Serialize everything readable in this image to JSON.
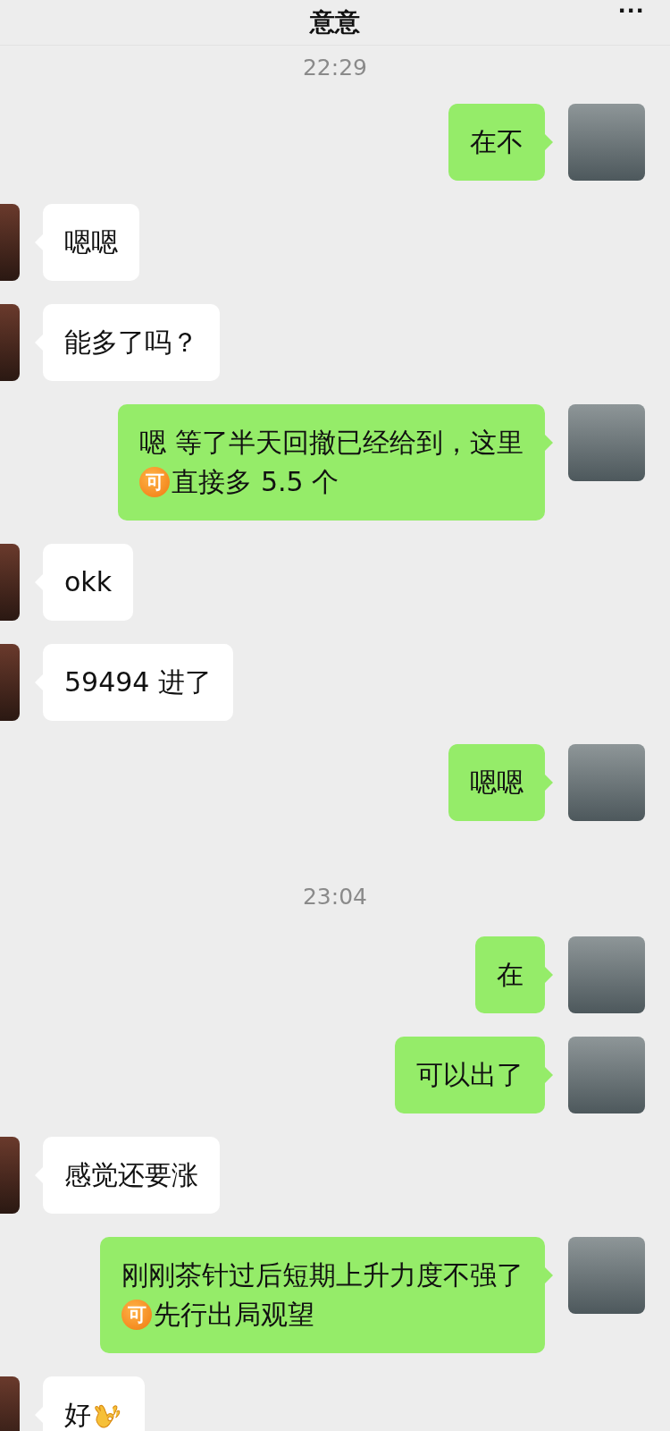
{
  "header": {
    "title": "意意",
    "more": "···"
  },
  "items": [
    {
      "kind": "time",
      "text": "22:29"
    },
    {
      "kind": "sent",
      "lines": [
        [
          {
            "kind": "text",
            "text": "在不"
          }
        ]
      ]
    },
    {
      "kind": "received",
      "lines": [
        [
          {
            "kind": "text",
            "text": "嗯嗯"
          }
        ]
      ]
    },
    {
      "kind": "received",
      "lines": [
        [
          {
            "kind": "text",
            "text": "能多了吗？"
          }
        ]
      ]
    },
    {
      "kind": "sent",
      "lines": [
        [
          {
            "kind": "text",
            "text": "嗯 等了半天回撤已经给到，这里"
          }
        ],
        [
          {
            "kind": "badge",
            "text": "可"
          },
          {
            "kind": "text",
            "text": "直接多 5.5 个"
          }
        ]
      ]
    },
    {
      "kind": "received",
      "lines": [
        [
          {
            "kind": "text",
            "text": "okk"
          }
        ]
      ]
    },
    {
      "kind": "received",
      "lines": [
        [
          {
            "kind": "text",
            "text": "59494 进了"
          }
        ]
      ]
    },
    {
      "kind": "sent",
      "lines": [
        [
          {
            "kind": "text",
            "text": "嗯嗯"
          }
        ]
      ]
    },
    {
      "kind": "time",
      "text": "23:04"
    },
    {
      "kind": "sent",
      "lines": [
        [
          {
            "kind": "text",
            "text": "在"
          }
        ]
      ]
    },
    {
      "kind": "sent",
      "lines": [
        [
          {
            "kind": "text",
            "text": "可以出了"
          }
        ]
      ]
    },
    {
      "kind": "received",
      "lines": [
        [
          {
            "kind": "text",
            "text": "感觉还要涨"
          }
        ]
      ]
    },
    {
      "kind": "sent",
      "lines": [
        [
          {
            "kind": "text",
            "text": "刚刚茶针过后短期上升力度不强了"
          }
        ],
        [
          {
            "kind": "badge",
            "text": "可"
          },
          {
            "kind": "text",
            "text": "先行出局观望"
          }
        ]
      ]
    },
    {
      "kind": "received",
      "lines": [
        [
          {
            "kind": "text",
            "text": "好"
          },
          {
            "kind": "ok_hand"
          }
        ]
      ]
    }
  ]
}
